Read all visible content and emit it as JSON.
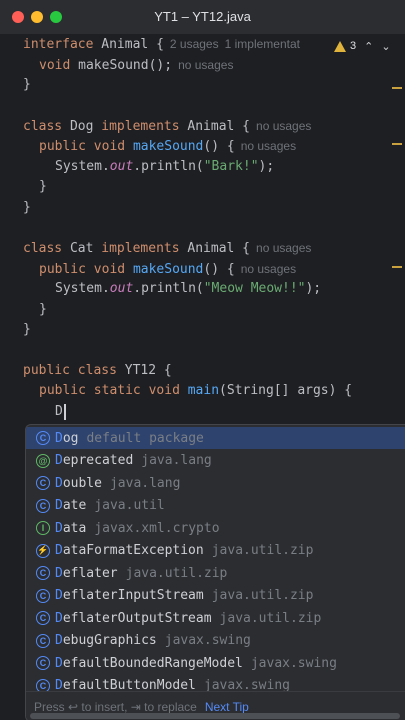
{
  "window": {
    "title": "YT1 – YT12.java"
  },
  "inspections": {
    "warning_count": "3",
    "up": "⌃",
    "down": "⌄"
  },
  "code": {
    "l1": {
      "kw": "interface",
      "name": "Animal",
      "brace": " {",
      "hint1": "2 usages",
      "hint2": "1 implementat"
    },
    "l2": {
      "kw": "void",
      "method": "makeSound",
      "rest": "();",
      "hint": "no usages"
    },
    "l3": "}",
    "l5": {
      "kw1": "class",
      "name": "Dog",
      "kw2": "implements",
      "iface": "Animal",
      "brace": " {",
      "hint": "no usages"
    },
    "l6": {
      "kw1": "public",
      "kw2": "void",
      "method": "makeSound",
      "rest": "() {",
      "hint": "no usages"
    },
    "l7": {
      "pre": "System.",
      "out": "out",
      "mid": ".println(",
      "str": "\"Bark!\"",
      "end": ");"
    },
    "l8": "}",
    "l9": "}",
    "l11": {
      "kw1": "class",
      "name": "Cat",
      "kw2": "implements",
      "iface": "Animal",
      "brace": " {",
      "hint": "no usages"
    },
    "l12": {
      "kw1": "public",
      "kw2": "void",
      "method": "makeSound",
      "rest": "() {",
      "hint": "no usages"
    },
    "l13": {
      "pre": "System.",
      "out": "out",
      "mid": ".println(",
      "str": "\"Meow Meow!!\"",
      "end": ");"
    },
    "l14": "}",
    "l15": "}",
    "l17": {
      "kw1": "public",
      "kw2": "class",
      "name": "YT12 {"
    },
    "l18": {
      "kw1": "public",
      "kw2": "static",
      "kw3": "void",
      "method": "main",
      "rest": "(String[] args) {"
    },
    "l19": "D"
  },
  "completion": {
    "items": [
      {
        "icon": "class-icon",
        "glyph": "C",
        "match": "D",
        "rest": "og",
        "pkg": "default package"
      },
      {
        "icon": "annotation-icon",
        "glyph": "@",
        "match": "D",
        "rest": "eprecated",
        "pkg": "java.lang"
      },
      {
        "icon": "class-icon",
        "glyph": "C",
        "match": "D",
        "rest": "ouble",
        "pkg": "java.lang"
      },
      {
        "icon": "class-icon",
        "glyph": "C",
        "match": "D",
        "rest": "ate",
        "pkg": "java.util"
      },
      {
        "icon": "interface-icon",
        "glyph": "I",
        "match": "D",
        "rest": "ata",
        "pkg": "javax.xml.crypto"
      },
      {
        "icon": "exception-icon",
        "glyph": "⚡",
        "match": "D",
        "rest": "ataFormatException",
        "pkg": "java.util.zip"
      },
      {
        "icon": "class-icon",
        "glyph": "C",
        "match": "D",
        "rest": "eflater",
        "pkg": "java.util.zip"
      },
      {
        "icon": "class-icon",
        "glyph": "C",
        "match": "D",
        "rest": "eflaterInputStream",
        "pkg": "java.util.zip"
      },
      {
        "icon": "class-icon",
        "glyph": "C",
        "match": "D",
        "rest": "eflaterOutputStream",
        "pkg": "java.util.zip"
      },
      {
        "icon": "class-icon",
        "glyph": "C",
        "match": "D",
        "rest": "ebugGraphics",
        "pkg": "javax.swing"
      },
      {
        "icon": "class-icon",
        "glyph": "C",
        "match": "D",
        "rest": "efaultBoundedRangeModel",
        "pkg": "javax.swing"
      },
      {
        "icon": "class-icon",
        "glyph": "C",
        "match": "D",
        "rest": "efaultButtonModel",
        "pkg": "javax.swing"
      }
    ],
    "footer": {
      "hint": "Press ↩ to insert, ⇥ to replace",
      "next_tip": "Next Tip"
    }
  },
  "colors": {
    "keyword": "#cf8e6d",
    "method": "#56a8f5",
    "string": "#6aab73",
    "static_field": "#c77dbb",
    "selection": "#2e436e",
    "warning": "#e0b33c"
  }
}
